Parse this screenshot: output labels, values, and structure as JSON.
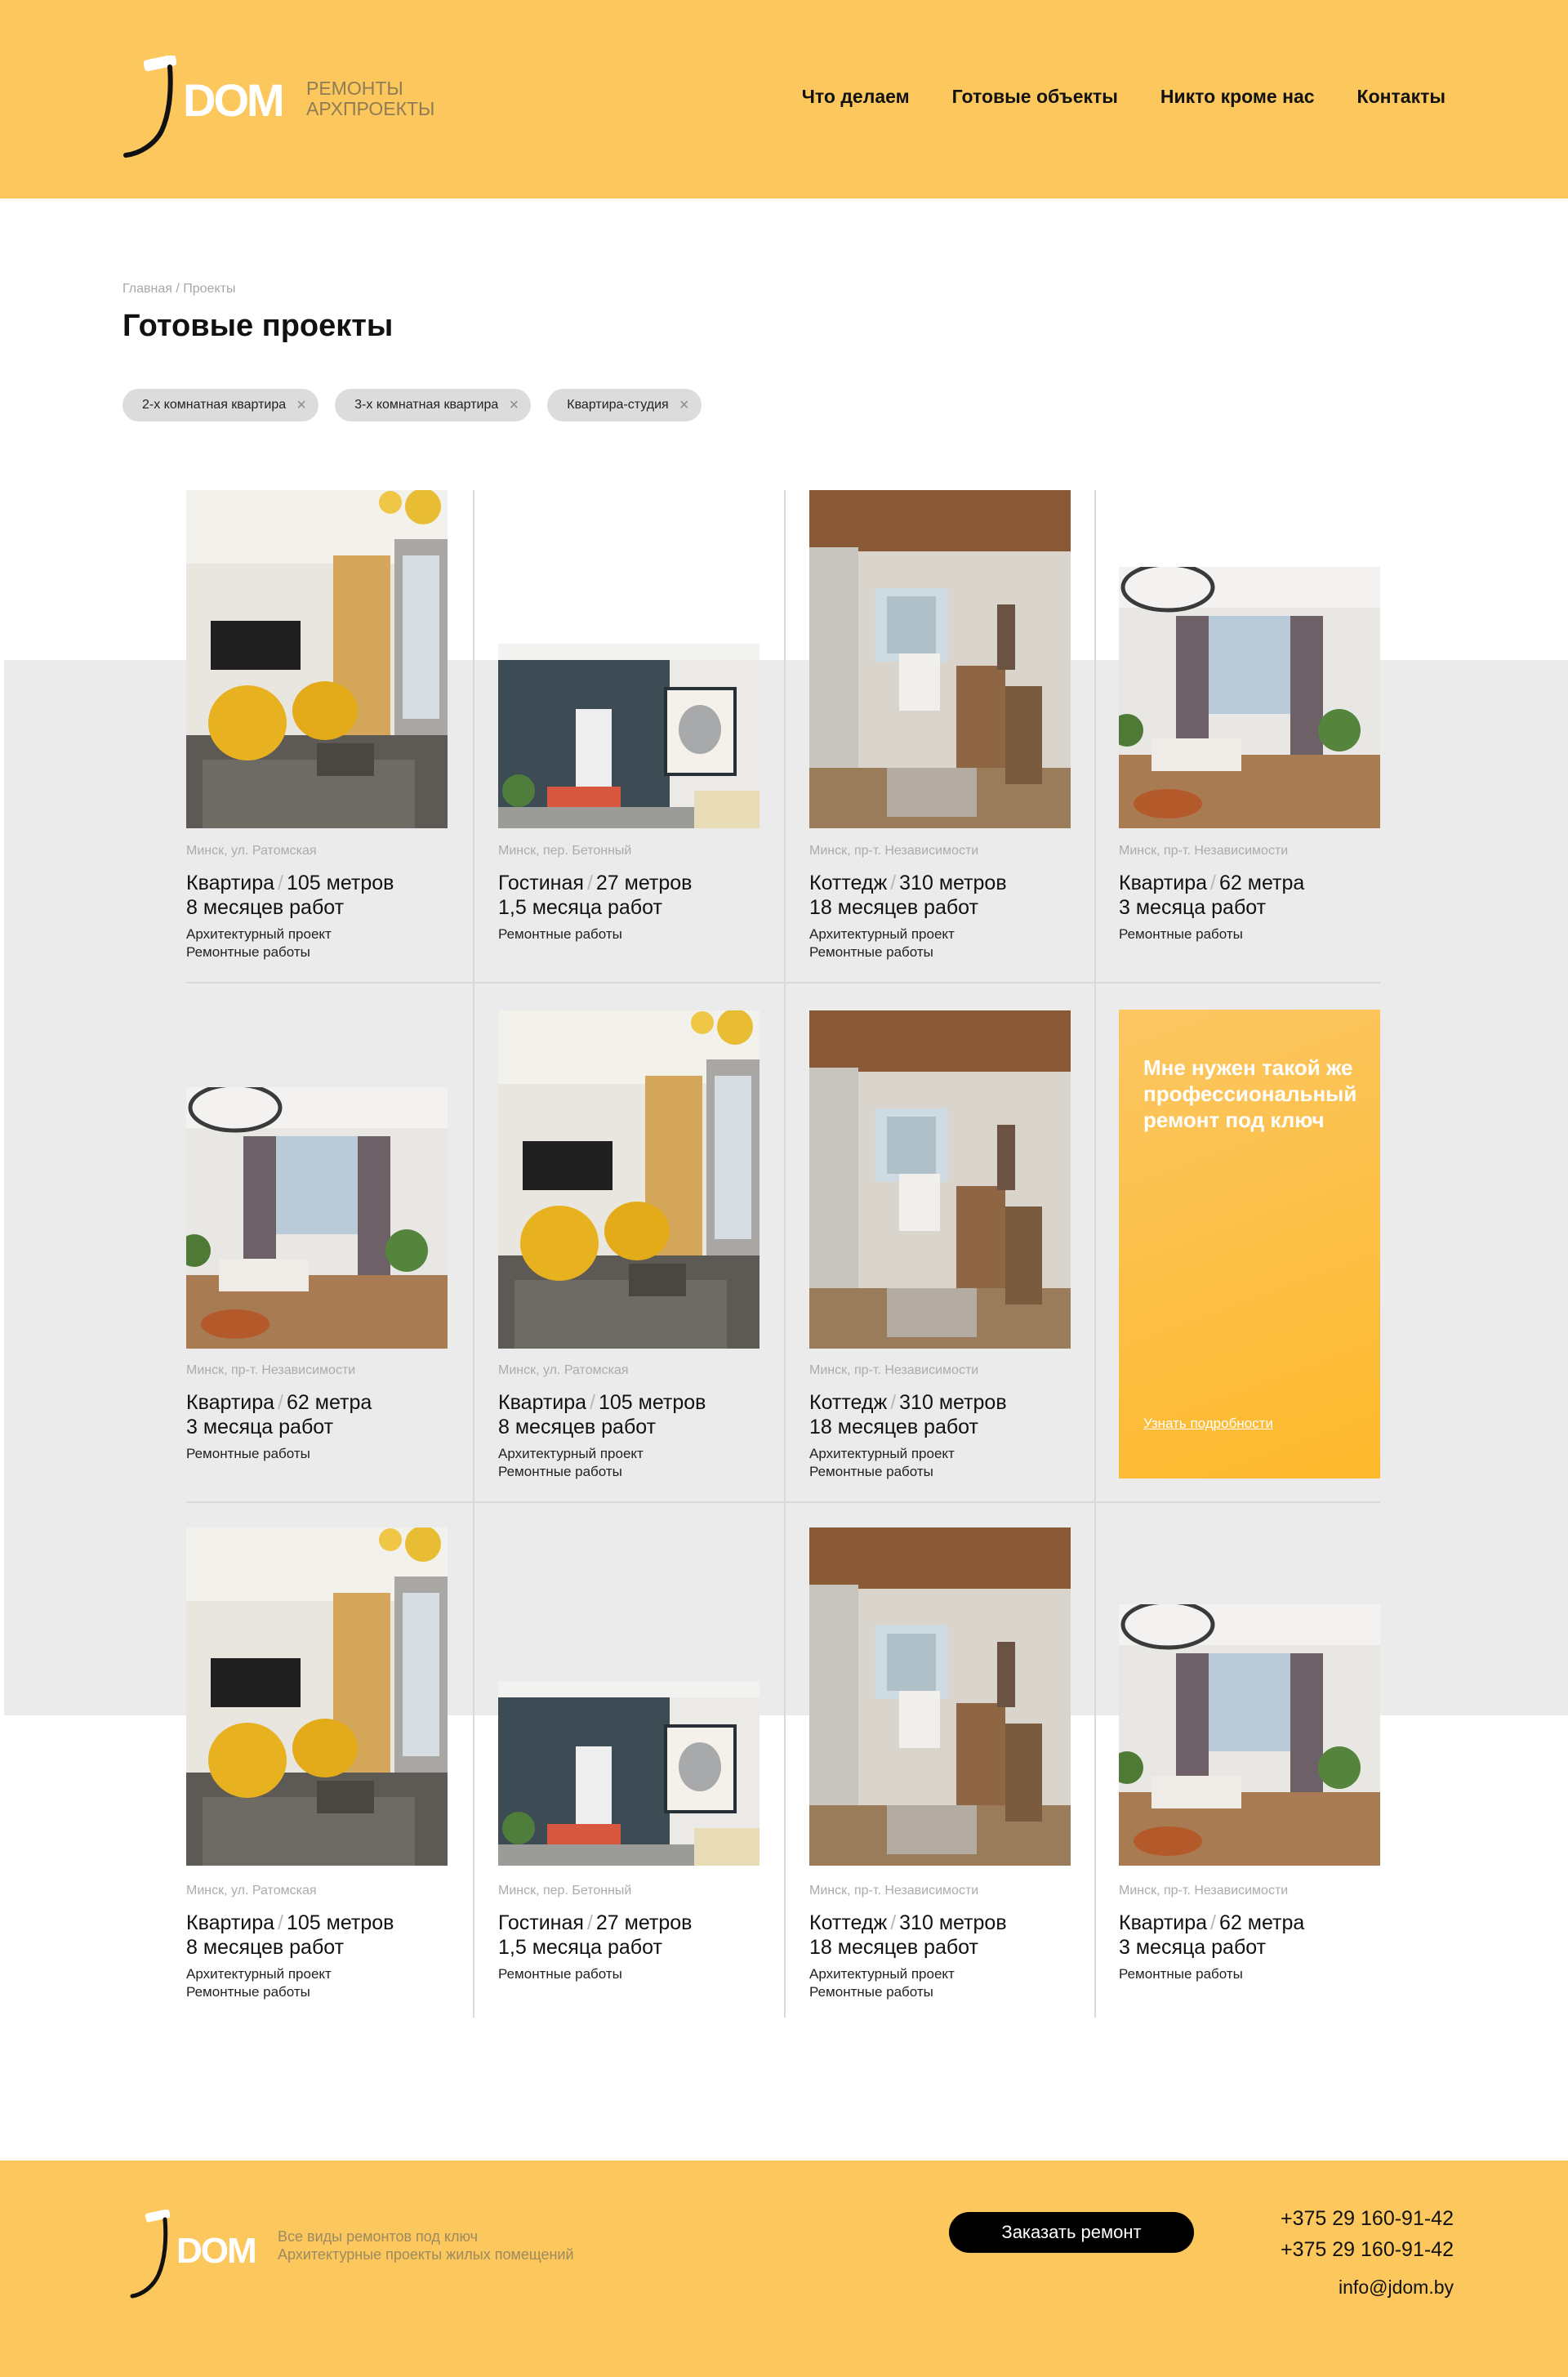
{
  "header": {
    "logo_text": "DOM",
    "logo_sub": [
      "Ремонты",
      "архпроекты"
    ],
    "nav": [
      {
        "label": "Что делаем"
      },
      {
        "label": "Готовые объекты"
      },
      {
        "label": "Никто кроме нас"
      },
      {
        "label": "Контакты"
      }
    ]
  },
  "breadcrumb": {
    "home": "Главная",
    "sep": " / ",
    "current": "Проекты"
  },
  "page_title": "Готовые проекты",
  "filters": [
    "2-х комнатная квартира",
    "3-х комнатная квартира",
    "Квартира-студия"
  ],
  "cards": [
    {
      "loc": "Минск, ул. Ратомская",
      "kind": "Квартира",
      "size": "105 метров",
      "dur": "8 месяцев работ",
      "services": [
        "Архитектурный проект",
        "Ремонтные работы"
      ],
      "photo": "living-room-yellow-chairs"
    },
    {
      "loc": "Минск, пер. Бетонный",
      "kind": "Гостиная",
      "size": "27 метров",
      "dur": "1,5 месяца работ",
      "services": [
        "Ремонтные работы"
      ],
      "photo": "hallway-cat-painting"
    },
    {
      "loc": "Минск, пр-т. Независимости",
      "kind": "Коттедж",
      "size": "310 метров",
      "dur": "18 месяцев работ",
      "services": [
        "Архитектурный проект",
        "Ремонтные работы"
      ],
      "photo": "bathroom-wood-ceiling"
    },
    {
      "loc": "Минск, пр-т. Независимости",
      "kind": "Квартира",
      "size": "62 метра",
      "dur": "3 месяца работ",
      "services": [
        "Ремонтные работы"
      ],
      "photo": "living-room-chandelier"
    },
    {
      "loc": "Минск, пр-т. Независимости",
      "kind": "Квартира",
      "size": "62 метра",
      "dur": "3 месяца работ",
      "services": [
        "Ремонтные работы"
      ],
      "photo": "living-room-chandelier"
    },
    {
      "loc": "Минск, ул. Ратомская",
      "kind": "Квартира",
      "size": "105 метров",
      "dur": "8 месяцев работ",
      "services": [
        "Архитектурный проект",
        "Ремонтные работы"
      ],
      "photo": "living-room-yellow-chairs"
    },
    {
      "loc": "Минск, пр-т. Независимости",
      "kind": "Коттедж",
      "size": "310 метров",
      "dur": "18 месяцев работ",
      "services": [
        "Архитектурный проект",
        "Ремонтные работы"
      ],
      "photo": "bathroom-wood-ceiling"
    },
    {
      "loc": "Минск, ул. Ратомская",
      "kind": "Квартира",
      "size": "105 метров",
      "dur": "8 месяцев работ",
      "services": [
        "Архитектурный проект",
        "Ремонтные работы"
      ],
      "photo": "living-room-yellow-chairs"
    },
    {
      "loc": "Минск, пер. Бетонный",
      "kind": "Гостиная",
      "size": "27 метров",
      "dur": "1,5 месяца работ",
      "services": [
        "Ремонтные работы"
      ],
      "photo": "hallway-cat-painting"
    },
    {
      "loc": "Минск, пр-т. Независимости",
      "kind": "Коттедж",
      "size": "310 метров",
      "dur": "18 месяцев работ",
      "services": [
        "Архитектурный проект",
        "Ремонтные работы"
      ],
      "photo": "bathroom-wood-ceiling"
    },
    {
      "loc": "Минск, пр-т. Независимости",
      "kind": "Квартира",
      "size": "62 метра",
      "dur": "3 месяца работ",
      "services": [
        "Ремонтные работы"
      ],
      "photo": "living-room-chandelier"
    }
  ],
  "promo": {
    "text": "Мне нужен такой же профессиональный ремонт под ключ",
    "link": "Узнать подробности"
  },
  "footer": {
    "logo_text": "DOM",
    "sub": [
      "Все виды ремонтов под ключ",
      "Архитектурные проекты жилых помещений"
    ],
    "order_button": "Заказать ремонт",
    "phones": [
      "+375 29 160-91-42",
      "+375 29 160-91-42"
    ],
    "email": "info@jdom.by"
  },
  "colors": {
    "accent": "#fcc75c",
    "promo_from": "#fcc763",
    "promo_to": "#fdb92b",
    "band": "#ebebeb"
  }
}
